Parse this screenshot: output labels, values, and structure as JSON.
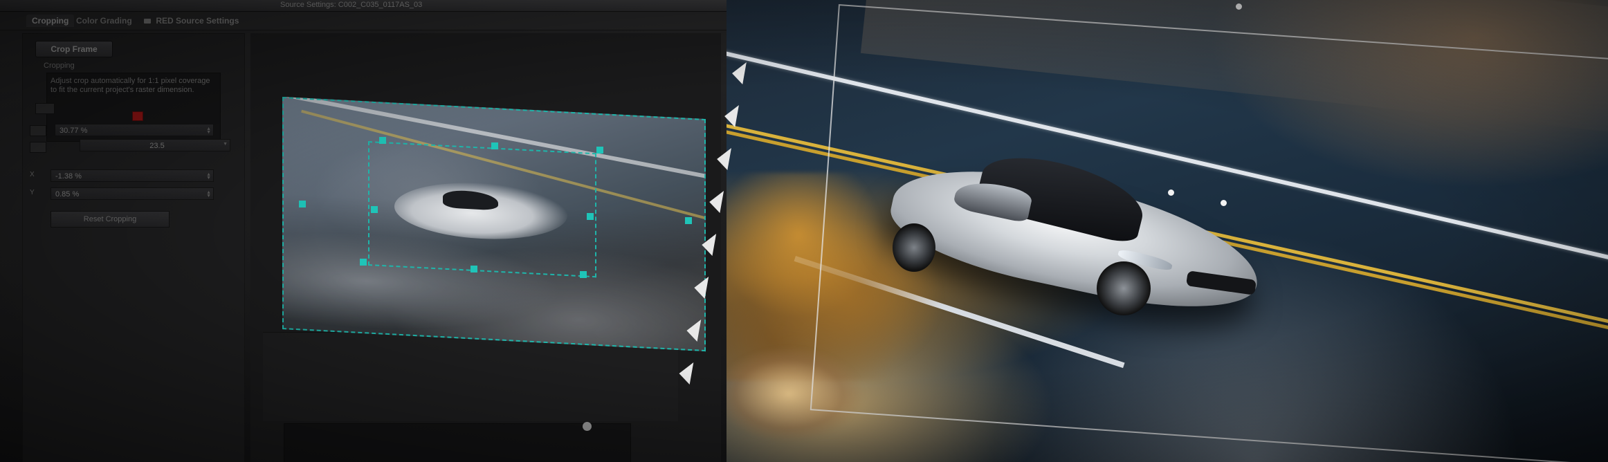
{
  "window": {
    "title": "Source Settings: C002_C035_0117AS_03"
  },
  "tabs": [
    {
      "label": "Cropping",
      "active": true
    },
    {
      "label": "Color Grading",
      "active": false
    },
    {
      "label": "RED Source Settings",
      "active": false
    }
  ],
  "settings": {
    "mode_button": "Crop Frame",
    "section_label": "Cropping",
    "info_text": "Adjust crop automatically for 1:1 pixel coverage to fit the current project's raster dimension.",
    "rows": [
      {
        "label": "",
        "value": "30.77 %"
      },
      {
        "label": "",
        "value": "23.5"
      },
      {
        "label": "X",
        "value": "-1.38 %"
      },
      {
        "label": "Y",
        "value": "0.85 %"
      }
    ],
    "reset_button": "Reset Cropping"
  },
  "colors": {
    "crop_accent": "#1fb5aa",
    "indicator_red": "#8a1313"
  },
  "icons": {
    "tab_icon": "film-icon",
    "filmstrip": "film-perforation-icon"
  }
}
